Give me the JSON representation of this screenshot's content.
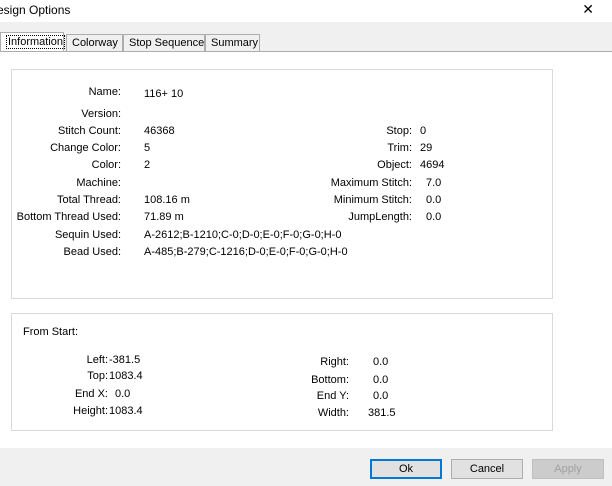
{
  "window": {
    "title": "esign Options"
  },
  "tabs": [
    {
      "label": "Information"
    },
    {
      "label": "Colorway"
    },
    {
      "label": "Stop Sequence"
    },
    {
      "label": "Summary"
    }
  ],
  "info": {
    "name": {
      "label": "Name:",
      "value": "116+ 10"
    },
    "version": {
      "label": "Version:",
      "value": ""
    },
    "stitch_count": {
      "label": "Stitch Count:",
      "value": "46368"
    },
    "change_color": {
      "label": "Change Color:",
      "value": "5"
    },
    "color": {
      "label": "Color:",
      "value": "2"
    },
    "machine": {
      "label": "Machine:",
      "value": ""
    },
    "total_thread": {
      "label": "Total Thread:",
      "value": "108.16 m"
    },
    "bottom_thread": {
      "label": "Bottom Thread Used:",
      "value": "71.89 m"
    },
    "sequin": {
      "label": "Sequin Used:",
      "value": "A-2612;B-1210;C-0;D-0;E-0;F-0;G-0;H-0"
    },
    "bead": {
      "label": "Bead Used:",
      "value": "A-485;B-279;C-1216;D-0;E-0;F-0;G-0;H-0"
    },
    "stop": {
      "label": "Stop:",
      "value": "0"
    },
    "trim": {
      "label": "Trim:",
      "value": "29"
    },
    "object": {
      "label": "Object:",
      "value": "4694"
    },
    "max_stitch": {
      "label": "Maximum Stitch:",
      "value": "7.0"
    },
    "min_stitch": {
      "label": "Minimum Stitch:",
      "value": "0.0"
    },
    "jump_length": {
      "label": "JumpLength:",
      "value": "0.0"
    }
  },
  "from_start": {
    "header": "From Start:",
    "left": {
      "label": "Left:",
      "value": "-381.5"
    },
    "top": {
      "label": "Top:",
      "value": "1083.4"
    },
    "end_x": {
      "label": "End X:",
      "value": "0.0"
    },
    "height": {
      "label": "Height:",
      "value": "1083.4"
    },
    "right": {
      "label": "Right:",
      "value": "0.0"
    },
    "bottom": {
      "label": "Bottom:",
      "value": "0.0"
    },
    "end_y": {
      "label": "End Y:",
      "value": "0.0"
    },
    "width": {
      "label": "Width:",
      "value": "381.5"
    }
  },
  "buttons": {
    "ok": "Ok",
    "cancel": "Cancel",
    "apply": "Apply"
  },
  "icons": {
    "close": "close-icon"
  }
}
